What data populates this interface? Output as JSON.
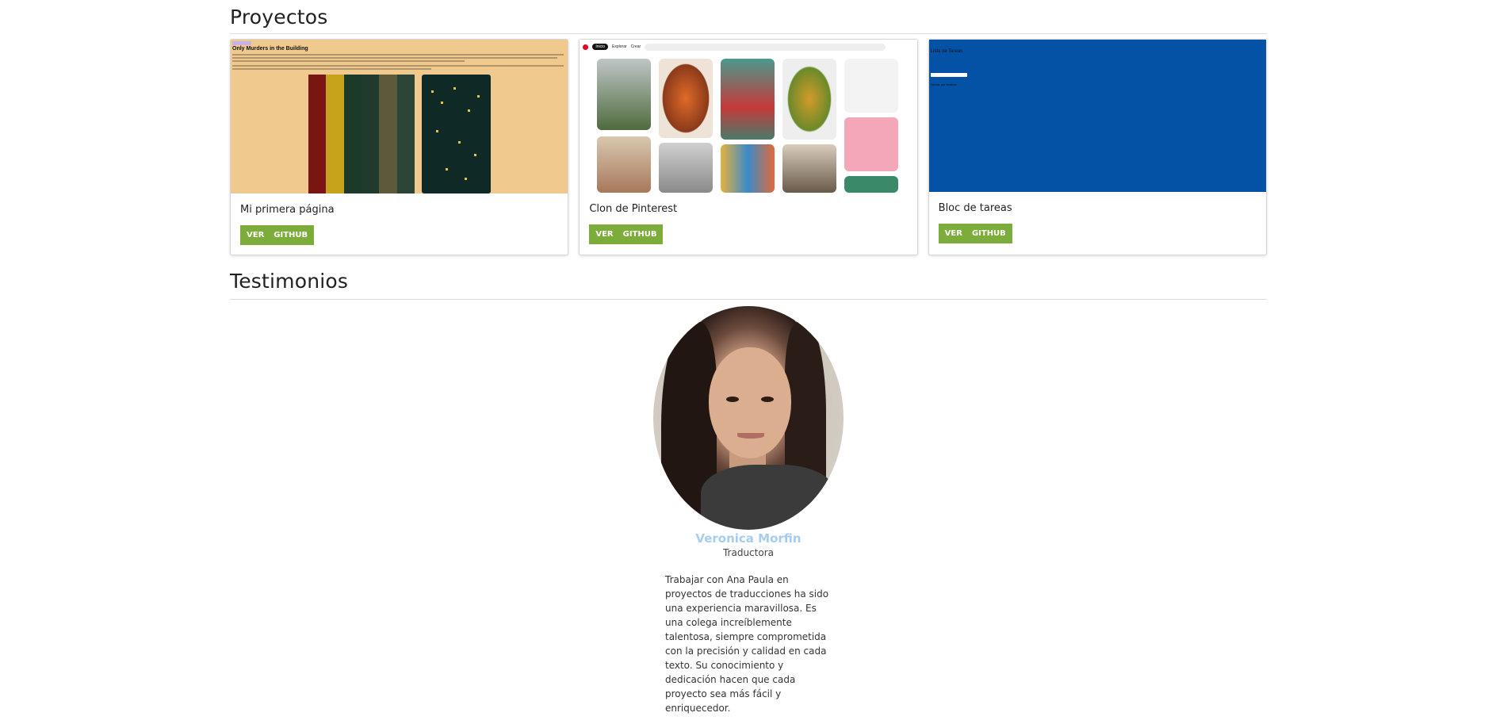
{
  "projects": {
    "title": "Proyectos",
    "cards": [
      {
        "title": "Mi primera página",
        "view_label": "VER",
        "github_label": "GITHUB",
        "preview": {
          "banner": "Only Murders in the Building",
          "poster_text": "ONLY MURDERS IN THE BUILDING"
        }
      },
      {
        "title": "Clon de Pinterest",
        "view_label": "VER",
        "github_label": "GITHUB",
        "preview": {
          "nav": [
            "Inicio",
            "Explorar",
            "Crear"
          ],
          "search": "Buscar"
        }
      },
      {
        "title": "Bloc de tareas",
        "view_label": "VER",
        "github_label": "GITHUB",
        "preview": {
          "heading": "Lista de Tareas",
          "subheading": "Tareas por realizar"
        }
      }
    ]
  },
  "testimonials": {
    "title": "Testimonios",
    "name": "Veronica Morfin",
    "role": "Traductora",
    "quote": "Trabajar con Ana Paula en proyectos de traducciones ha sido una experiencia maravillosa. Es una colega increíblemente talentosa, siempre comprometida con la precisión y calidad en cada texto. Su conocimiento y dedicación hacen que cada proyecto sea más fácil y enriquecedor."
  },
  "colors": {
    "button": "#7cac3a",
    "name": "#a5cdf0",
    "card3_bg": "#0452a5"
  }
}
